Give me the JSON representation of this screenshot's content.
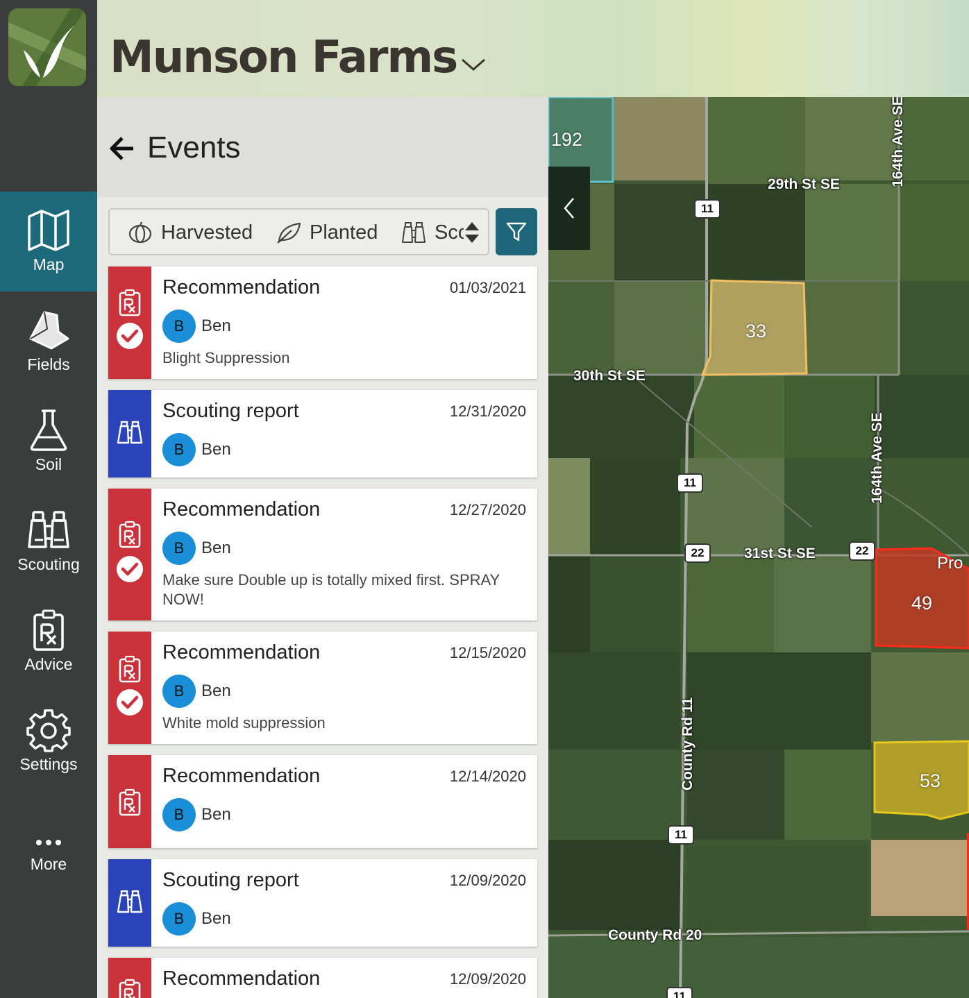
{
  "app": {
    "farm_name": "Munson Farms"
  },
  "nav": {
    "items": [
      {
        "label": "Map",
        "icon": "map-icon",
        "active": true
      },
      {
        "label": "Fields",
        "icon": "field-shape-icon"
      },
      {
        "label": "Soil",
        "icon": "flask-icon"
      },
      {
        "label": "Scouting",
        "icon": "binoculars-icon"
      },
      {
        "label": "Advice",
        "icon": "clipboard-rx-icon"
      },
      {
        "label": "Settings",
        "icon": "gear-icon"
      },
      {
        "label": "More",
        "icon": "more-dots-icon"
      }
    ],
    "active_color": "#1d6a7a"
  },
  "panel": {
    "title": "Events",
    "filters": [
      {
        "label": "Harvested",
        "icon": "pumpkin-icon"
      },
      {
        "label": "Planted",
        "icon": "leaf-icon"
      },
      {
        "label": "Sco",
        "icon": "binoculars-icon"
      }
    ],
    "filter_button_color": "#1e6679",
    "events": [
      {
        "type": "Recommendation",
        "date": "01/03/2021",
        "user_initial": "B",
        "user": "Ben",
        "note": "Blight Suppression",
        "completed": true,
        "color": "#c9323a"
      },
      {
        "type": "Scouting report",
        "date": "12/31/2020",
        "user_initial": "B",
        "user": "Ben",
        "note": "",
        "completed": false,
        "color": "#2b43b8"
      },
      {
        "type": "Recommendation",
        "date": "12/27/2020",
        "user_initial": "B",
        "user": "Ben",
        "note": "Make sure Double up is totally mixed first. SPRAY NOW!",
        "completed": true,
        "color": "#c9323a"
      },
      {
        "type": "Recommendation",
        "date": "12/15/2020",
        "user_initial": "B",
        "user": "Ben",
        "note": "White mold suppression",
        "completed": true,
        "color": "#c9323a"
      },
      {
        "type": "Recommendation",
        "date": "12/14/2020",
        "user_initial": "B",
        "user": "Ben",
        "note": "",
        "completed": false,
        "color": "#c9323a"
      },
      {
        "type": "Scouting report",
        "date": "12/09/2020",
        "user_initial": "B",
        "user": "Ben",
        "note": "",
        "completed": false,
        "color": "#2b43b8"
      },
      {
        "type": "Recommendation",
        "date": "12/09/2020",
        "user_initial": "",
        "user": "",
        "note": "",
        "completed": false,
        "color": "#c9323a"
      }
    ]
  },
  "map": {
    "roads": {
      "29th": "29th St SE",
      "30th": "30th St SE",
      "31st": "31st St SE",
      "164th_top": "164th Ave SE",
      "164th_mid": "164th Ave SE",
      "county11": "County Rd 11",
      "county20": "County Rd 20"
    },
    "shields": [
      "11",
      "11",
      "22",
      "22",
      "11",
      "11"
    ],
    "fields": [
      {
        "label": "192",
        "color": "#5fc3c9"
      },
      {
        "label": "33",
        "color": "#e8b85a"
      },
      {
        "label": "49",
        "color": "#d9331f"
      },
      {
        "label": "53",
        "color": "#e0c31c"
      },
      {
        "label": "Pro",
        "color": "#d9331f"
      }
    ]
  }
}
